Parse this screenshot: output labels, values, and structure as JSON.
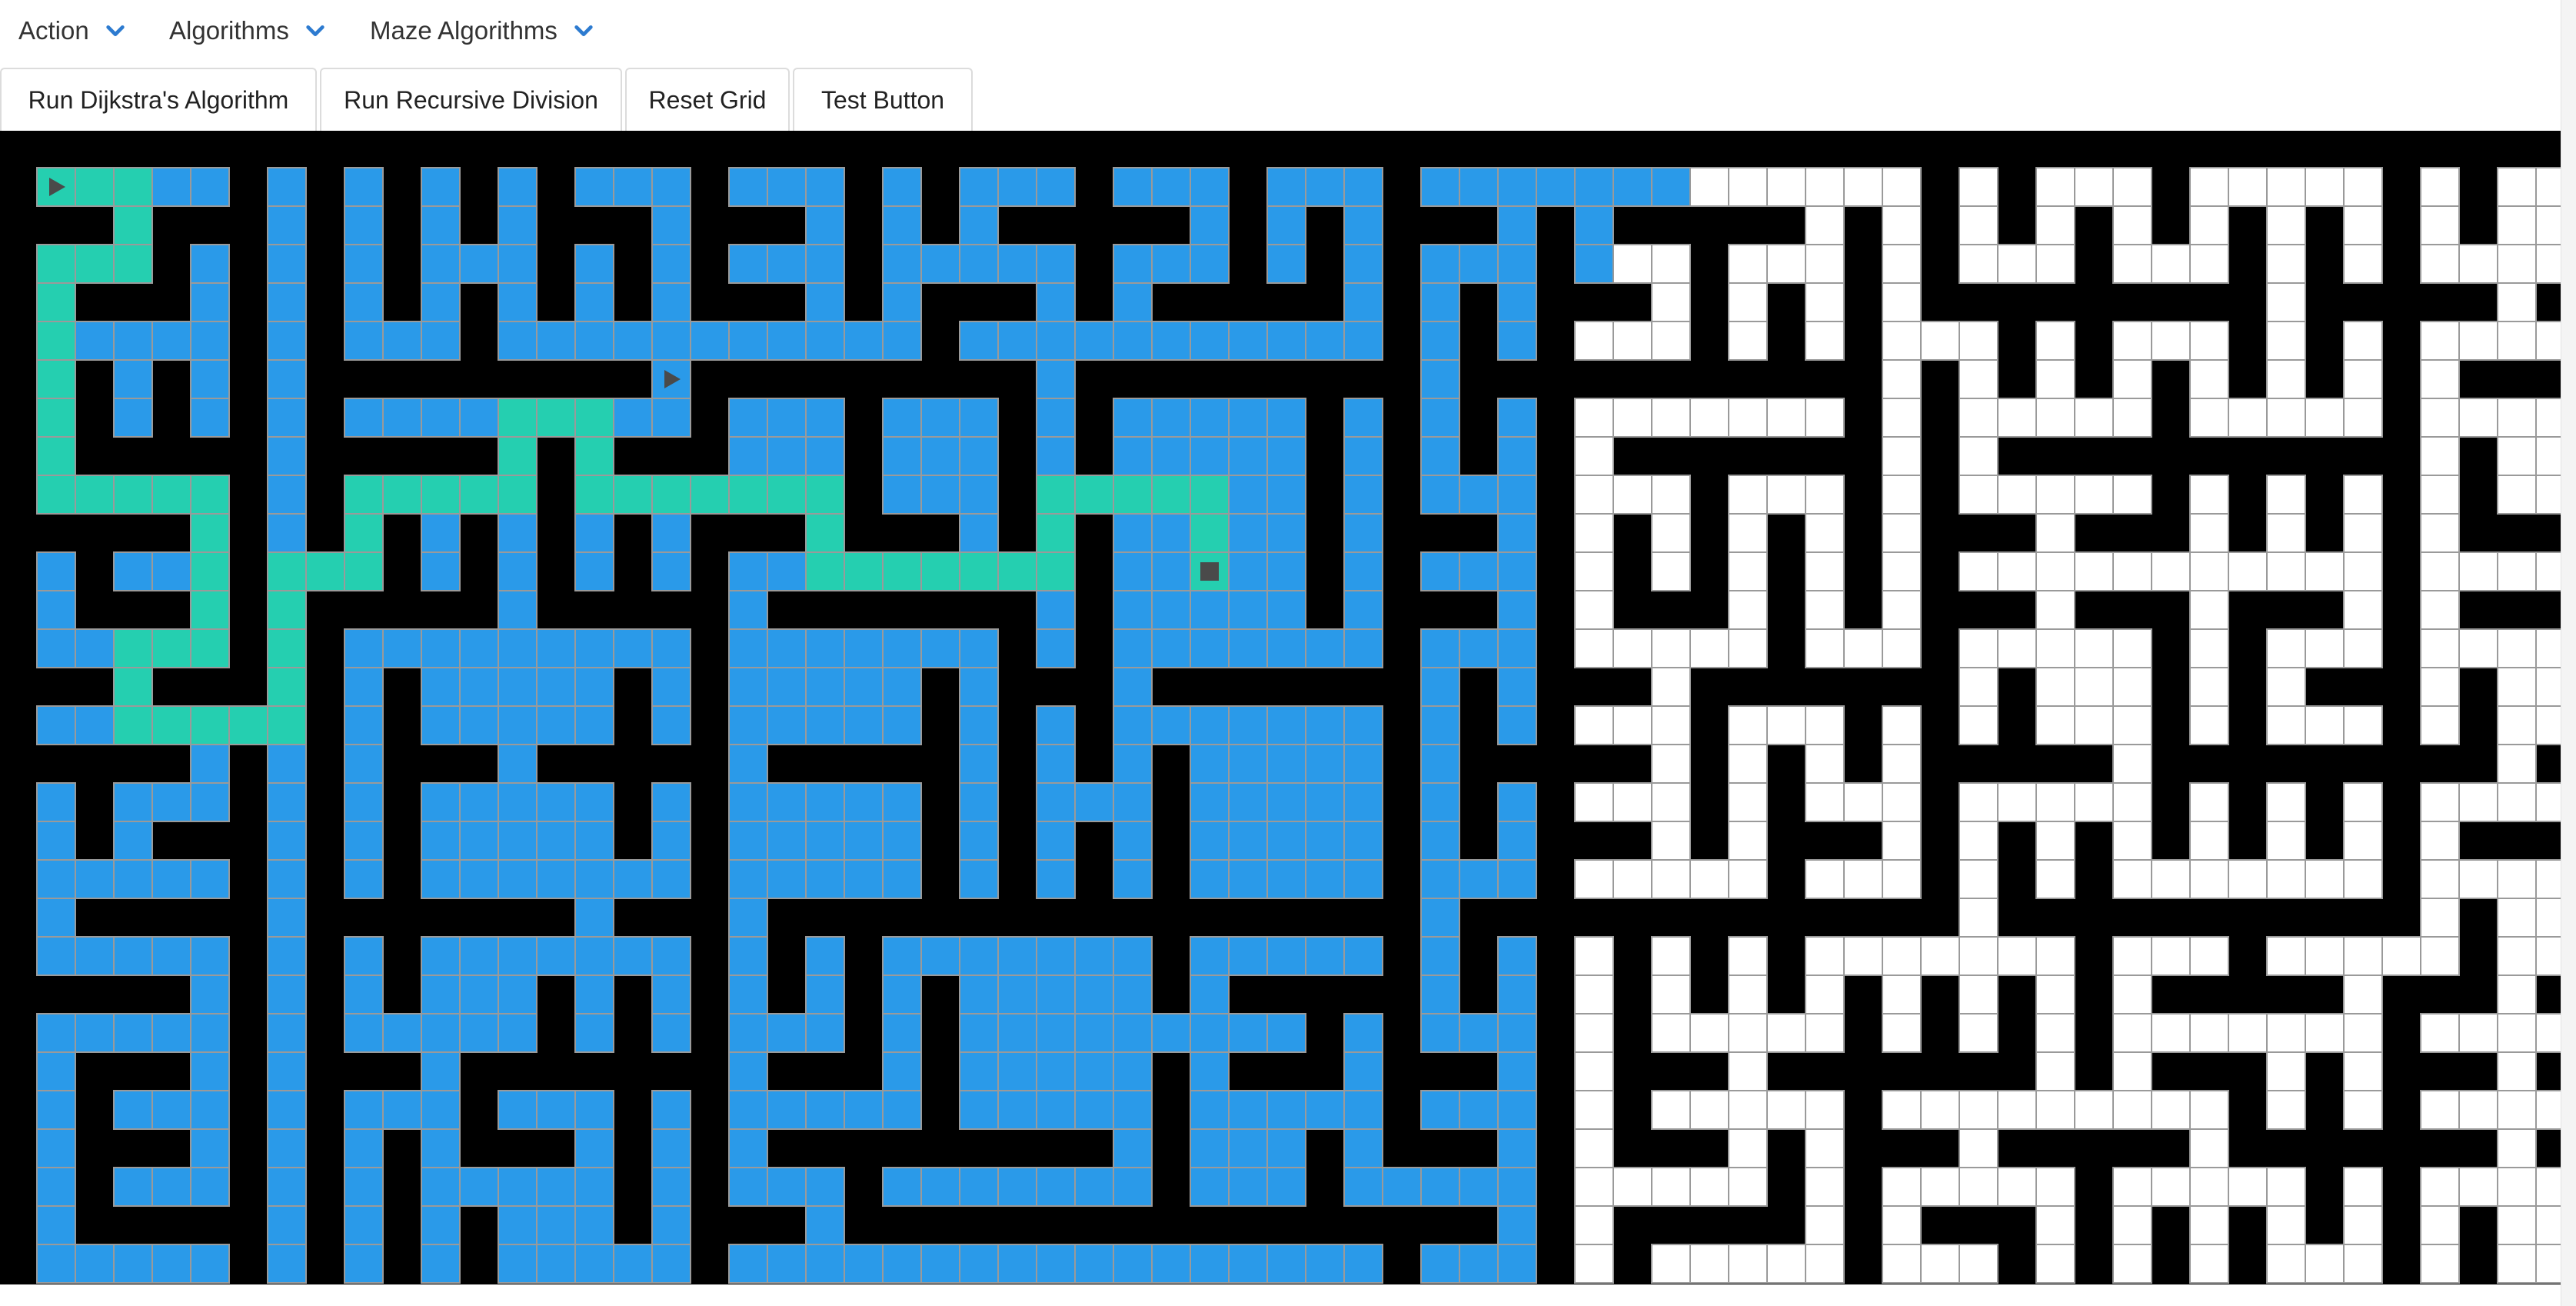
{
  "menu": [
    {
      "label": "Action",
      "icon": "chevron-down-icon"
    },
    {
      "label": "Algorithms",
      "icon": "chevron-down-icon"
    },
    {
      "label": "Maze Algorithms",
      "icon": "chevron-down-icon"
    }
  ],
  "toolbar": {
    "buttons": [
      {
        "label": "Run Dijkstra's Algorithm"
      },
      {
        "label": "Run Recursive Division"
      },
      {
        "label": "Reset Grid"
      },
      {
        "label": "Test Button"
      }
    ]
  },
  "colors": {
    "accent": "#2d7bd0",
    "wall": "#000000",
    "unvisited": "#ffffff",
    "visited": "#2a9ae9",
    "path": "#25cfb0",
    "cell_border": "#9a9a9a",
    "marker": "#4a4a4a"
  },
  "grid": {
    "cols": 66,
    "rows": 29,
    "start_node": {
      "row": 0,
      "col": 0,
      "icon": "play-triangle-icon"
    },
    "mid_node": {
      "row": 5,
      "col": 16,
      "icon": "play-triangle-icon"
    },
    "target_node": {
      "row": 10,
      "col": 30,
      "icon": "square-icon"
    }
  }
}
